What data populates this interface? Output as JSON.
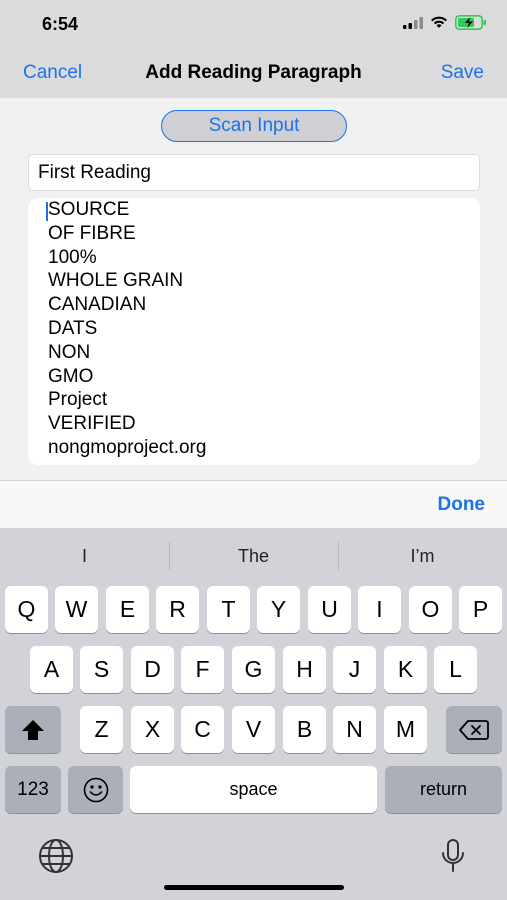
{
  "status_bar": {
    "time": "6:54"
  },
  "nav": {
    "left": "Cancel",
    "title": "Add Reading Paragraph",
    "right": "Save"
  },
  "form": {
    "scan_button": "Scan Input",
    "title_value": "First Reading",
    "body_lines": [
      "SOURCE",
      "OF FIBRE",
      "100%",
      "WHOLE GRAIN",
      "CANADIAN",
      "DATS",
      "NON",
      "GMO",
      "Project",
      "VERIFIED",
      "nongmoproject.org"
    ]
  },
  "toolbar": {
    "done": "Done"
  },
  "keyboard": {
    "suggestions": [
      "I",
      "The",
      "I’m"
    ],
    "row1": [
      "Q",
      "W",
      "E",
      "R",
      "T",
      "Y",
      "U",
      "I",
      "O",
      "P"
    ],
    "row2": [
      "A",
      "S",
      "D",
      "F",
      "G",
      "H",
      "J",
      "K",
      "L"
    ],
    "row3": [
      "Z",
      "X",
      "C",
      "V",
      "B",
      "N",
      "M"
    ],
    "numbers_key": "123",
    "space_key": "space",
    "return_key": "return"
  },
  "colors": {
    "accent": "#1a73e8",
    "battery": "#34c759"
  }
}
